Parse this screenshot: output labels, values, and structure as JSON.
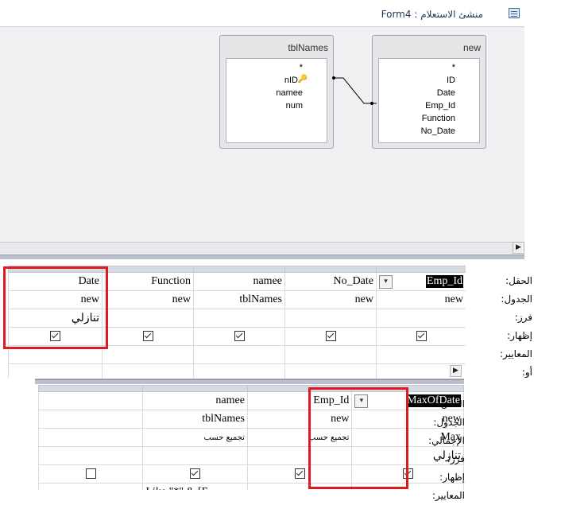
{
  "window": {
    "title": "منشئ الاستعلام : Form4",
    "icon": "form-icon"
  },
  "tables": {
    "tblNames": {
      "title": "tblNames",
      "fields": [
        "*",
        "nID",
        "namee",
        "num"
      ],
      "key_field": "nID"
    },
    "new": {
      "title": "new",
      "fields": [
        "*",
        "ID",
        "Date",
        "Emp_Id",
        "Function",
        "No_Date"
      ]
    }
  },
  "grid1": {
    "row_labels": [
      "الحقل:",
      "الجدول:",
      "فرز:",
      "إظهار:",
      "المعايير:",
      "أو:"
    ],
    "columns": [
      {
        "field": "Emp_Id",
        "table": "new",
        "sort": "",
        "show": true,
        "selected": true
      },
      {
        "field": "No_Date",
        "table": "new",
        "sort": "",
        "show": true
      },
      {
        "field": "namee",
        "table": "tblNames",
        "sort": "",
        "show": true
      },
      {
        "field": "Function",
        "table": "new",
        "sort": "",
        "show": true
      },
      {
        "field": "Date",
        "table": "new",
        "sort": "تنازلي",
        "show": true
      }
    ]
  },
  "grid2": {
    "row_labels": [
      "الحقل:",
      "الجدول:",
      "الإجمالي:",
      "فرز:",
      "إظهار:",
      "المعايير:"
    ],
    "columns": [
      {
        "field": "MaxOfDate",
        "table": "new",
        "total": "Max",
        "sort": "تنازلي",
        "show": true,
        "selected": true
      },
      {
        "field": "Emp_Id",
        "table": "new",
        "total": "تجميع حسب",
        "sort": "",
        "show": true,
        "criteria": ""
      },
      {
        "field": "namee",
        "table": "tblNames",
        "total": "تجميع حسب",
        "sort": "",
        "show": true,
        "criteria": "Like \"*\" & [F"
      },
      {
        "field": "",
        "table": "",
        "total": "",
        "sort": "",
        "show": false,
        "criteria": ""
      }
    ]
  },
  "colors": {
    "highlight_box": "#e0191f",
    "pane_bg": "#f1f1f4"
  }
}
